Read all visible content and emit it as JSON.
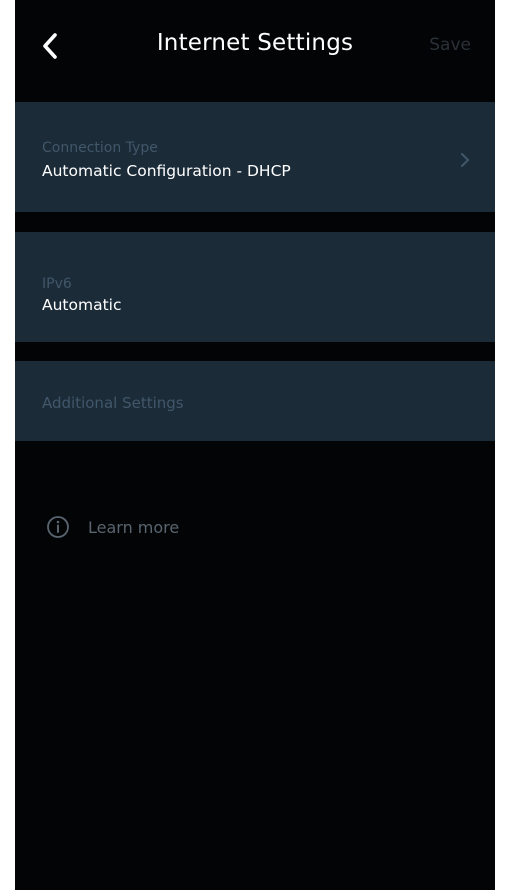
{
  "header": {
    "back_icon": "chevron-left-icon",
    "title": "Internet Settings",
    "save_label": "Save"
  },
  "connection_type": {
    "label": "Connection Type",
    "value": "Automatic Configuration - DHCP",
    "icon": "chevron-right-icon"
  },
  "ipv6": {
    "label": "IPv6",
    "value": "Automatic"
  },
  "additional_settings": {
    "label": "Additional Settings"
  },
  "learn_more": {
    "icon": "info-icon",
    "label": "Learn more"
  },
  "colors": {
    "background": "#020405",
    "card": "#1b2b38",
    "muted_label": "#41576a",
    "disabled_save": "#2a3138"
  }
}
